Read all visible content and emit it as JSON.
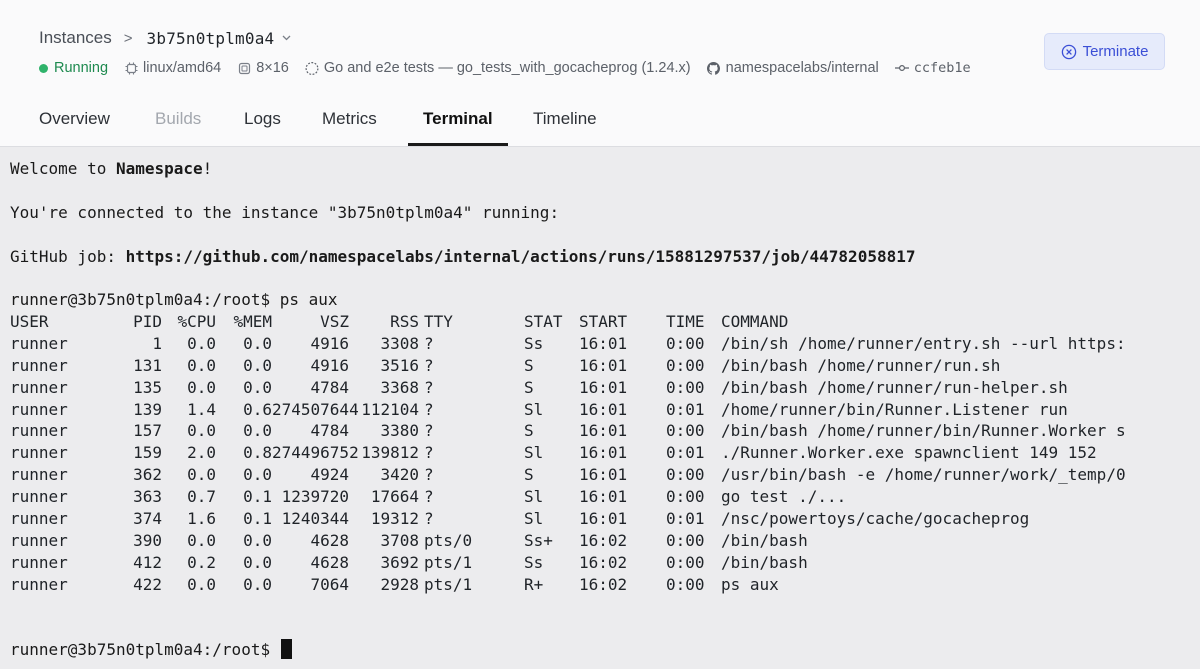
{
  "breadcrumb": {
    "parent": "Instances",
    "separator": ">",
    "current": "3b75n0tplm0a4"
  },
  "meta": {
    "status": "Running",
    "platform": "linux/amd64",
    "shape": "8×16",
    "job": "Go and e2e tests — go_tests_with_gocacheprog (1.24.x)",
    "repo": "namespacelabs/internal",
    "commit": "ccfeb1e"
  },
  "actions": {
    "terminate_label": "Terminate"
  },
  "tabs": [
    {
      "label": "Overview"
    },
    {
      "label": "Builds"
    },
    {
      "label": "Logs"
    },
    {
      "label": "Metrics"
    },
    {
      "label": "Terminal"
    },
    {
      "label": "Timeline"
    }
  ],
  "terminal": {
    "welcome_prefix": "Welcome to ",
    "welcome_brand": "Namespace",
    "welcome_suffix": "!",
    "connected": "You're connected to the instance \"3b75n0tplm0a4\" running:",
    "github_prefix": "GitHub job: ",
    "github_url": "https://github.com/namespacelabs/internal/actions/runs/15881297537/job/44782058817",
    "prompt": "runner@3b75n0tplm0a4:/root$",
    "command": " ps aux",
    "ps_header": [
      "USER",
      "PID",
      "%CPU",
      "%MEM",
      "VSZ",
      "RSS",
      "TTY",
      "STAT",
      "START",
      "TIME",
      "COMMAND"
    ],
    "ps_rows": [
      [
        "runner",
        "1",
        "0.0",
        "0.0",
        "4916",
        "3308",
        "?",
        "Ss",
        "16:01",
        "0:00",
        "/bin/sh /home/runner/entry.sh --url https:"
      ],
      [
        "runner",
        "131",
        "0.0",
        "0.0",
        "4916",
        "3516",
        "?",
        "S",
        "16:01",
        "0:00",
        "/bin/bash /home/runner/run.sh"
      ],
      [
        "runner",
        "135",
        "0.0",
        "0.0",
        "4784",
        "3368",
        "?",
        "S",
        "16:01",
        "0:00",
        "/bin/bash /home/runner/run-helper.sh"
      ],
      [
        "runner",
        "139",
        "1.4",
        "0.6",
        "274507644",
        "112104",
        "?",
        "Sl",
        "16:01",
        "0:01",
        "/home/runner/bin/Runner.Listener run"
      ],
      [
        "runner",
        "157",
        "0.0",
        "0.0",
        "4784",
        "3380",
        "?",
        "S",
        "16:01",
        "0:00",
        "/bin/bash /home/runner/bin/Runner.Worker s"
      ],
      [
        "runner",
        "159",
        "2.0",
        "0.8",
        "274496752",
        "139812",
        "?",
        "Sl",
        "16:01",
        "0:01",
        "./Runner.Worker.exe spawnclient 149 152"
      ],
      [
        "runner",
        "362",
        "0.0",
        "0.0",
        "4924",
        "3420",
        "?",
        "S",
        "16:01",
        "0:00",
        "/usr/bin/bash -e /home/runner/work/_temp/0"
      ],
      [
        "runner",
        "363",
        "0.7",
        "0.1",
        "1239720",
        "17664",
        "?",
        "Sl",
        "16:01",
        "0:00",
        "go test ./..."
      ],
      [
        "runner",
        "374",
        "1.6",
        "0.1",
        "1240344",
        "19312",
        "?",
        "Sl",
        "16:01",
        "0:01",
        "/nsc/powertoys/cache/gocacheprog"
      ],
      [
        "runner",
        "390",
        "0.0",
        "0.0",
        "4628",
        "3708",
        "pts/0",
        "Ss+",
        "16:02",
        "0:00",
        "/bin/bash"
      ],
      [
        "runner",
        "412",
        "0.2",
        "0.0",
        "4628",
        "3692",
        "pts/1",
        "Ss",
        "16:02",
        "0:00",
        "/bin/bash"
      ],
      [
        "runner",
        "422",
        "0.0",
        "0.0",
        "7064",
        "2928",
        "pts/1",
        "R+",
        "16:02",
        "0:00",
        "ps aux"
      ]
    ],
    "final_prompt": "runner@3b75n0tplm0a4:/root$"
  }
}
